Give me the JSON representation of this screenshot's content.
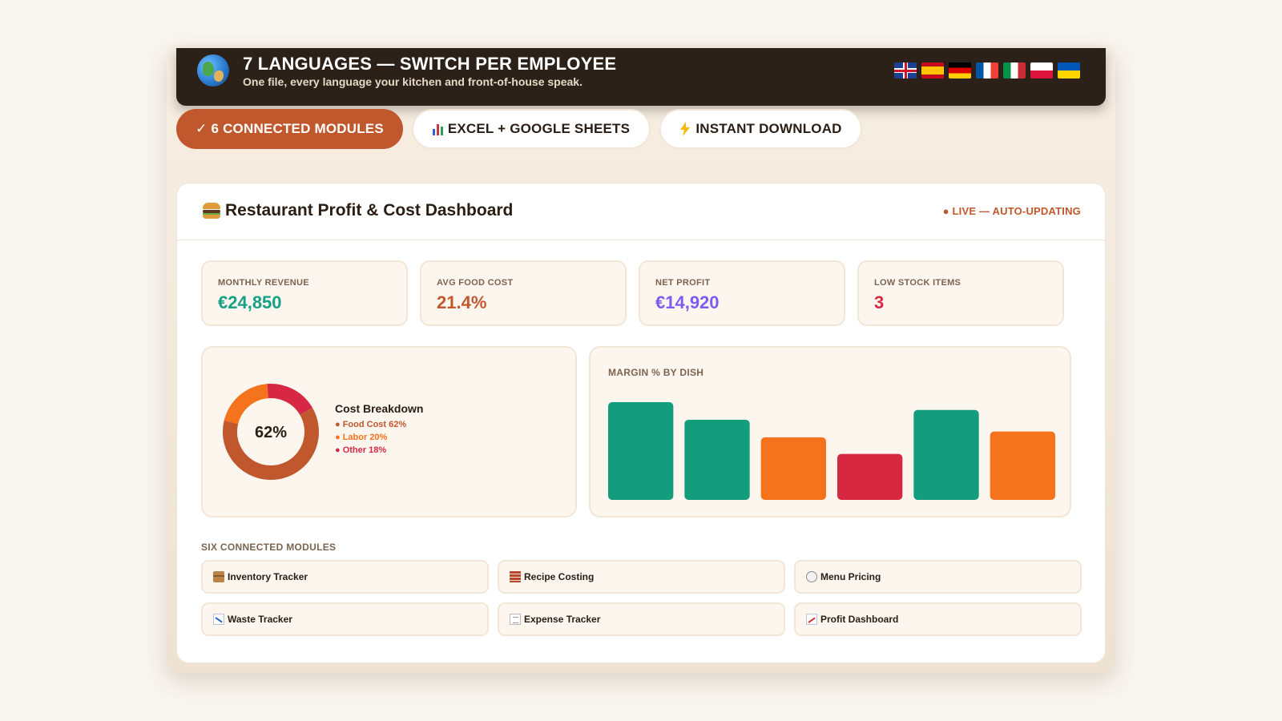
{
  "banner": {
    "icon": "globe-icon",
    "title": "7 LANGUAGES — SWITCH PER EMPLOYEE",
    "subtitle": "One file, every language your kitchen and front-of-house speak.",
    "flags": [
      "gb-flag-icon",
      "es-flag-icon",
      "de-flag-icon",
      "fr-flag-icon",
      "it-flag-icon",
      "pl-flag-icon",
      "ua-flag-icon"
    ]
  },
  "features": [
    {
      "label": "✓ 6 CONNECTED MODULES",
      "icon": "checkmark-icon"
    },
    {
      "label": "EXCEL + GOOGLE SHEETS",
      "icon": "bar-chart-icon"
    },
    {
      "label": "INSTANT DOWNLOAD",
      "icon": "lightning-icon"
    }
  ],
  "dashboard": {
    "title": "Restaurant Profit & Cost Dashboard",
    "title_icon": "burger-icon",
    "status": "● LIVE — AUTO-UPDATING",
    "accent_color": "#c1582d"
  },
  "kpis": [
    {
      "label": "MONTHLY REVENUE",
      "value": "€24,850",
      "color": "#16a085"
    },
    {
      "label": "AVG FOOD COST",
      "value": "21.4%",
      "color": "#c1582d"
    },
    {
      "label": "NET PROFIT",
      "value": "€14,920",
      "color": "#7b5cf0"
    },
    {
      "label": "LOW STOCK ITEMS",
      "value": "3",
      "color": "#d62845"
    }
  ],
  "cost_breakdown": {
    "title": "Cost Breakdown",
    "center_label": "62%",
    "items": [
      {
        "label": "● Food Cost 62%",
        "value": 62,
        "color": "#c1582d"
      },
      {
        "label": "● Labor 20%",
        "value": 20,
        "color": "#f5731c"
      },
      {
        "label": "● Other 18%",
        "value": 18,
        "color": "#d62845"
      }
    ]
  },
  "chart_data": {
    "type": "bar",
    "title": "MARGIN % BY DISH",
    "categories": [],
    "values": [
      100,
      82,
      64,
      47,
      92,
      70
    ],
    "colors": [
      "#139d7d",
      "#139d7d",
      "#f5731c",
      "#d62840",
      "#139d7d",
      "#f5731c"
    ],
    "ylim": [
      0,
      100
    ],
    "grid": false
  },
  "modules": {
    "title": "SIX CONNECTED MODULES",
    "items": [
      {
        "label": "Inventory Tracker",
        "icon": "package-icon"
      },
      {
        "label": "Recipe Costing",
        "icon": "brick-icon"
      },
      {
        "label": "Menu Pricing",
        "icon": "plate-icon"
      },
      {
        "label": "Waste Tracker",
        "icon": "chart-down-icon"
      },
      {
        "label": "Expense Tracker",
        "icon": "receipt-icon"
      },
      {
        "label": "Profit Dashboard",
        "icon": "chart-up-icon"
      }
    ]
  }
}
